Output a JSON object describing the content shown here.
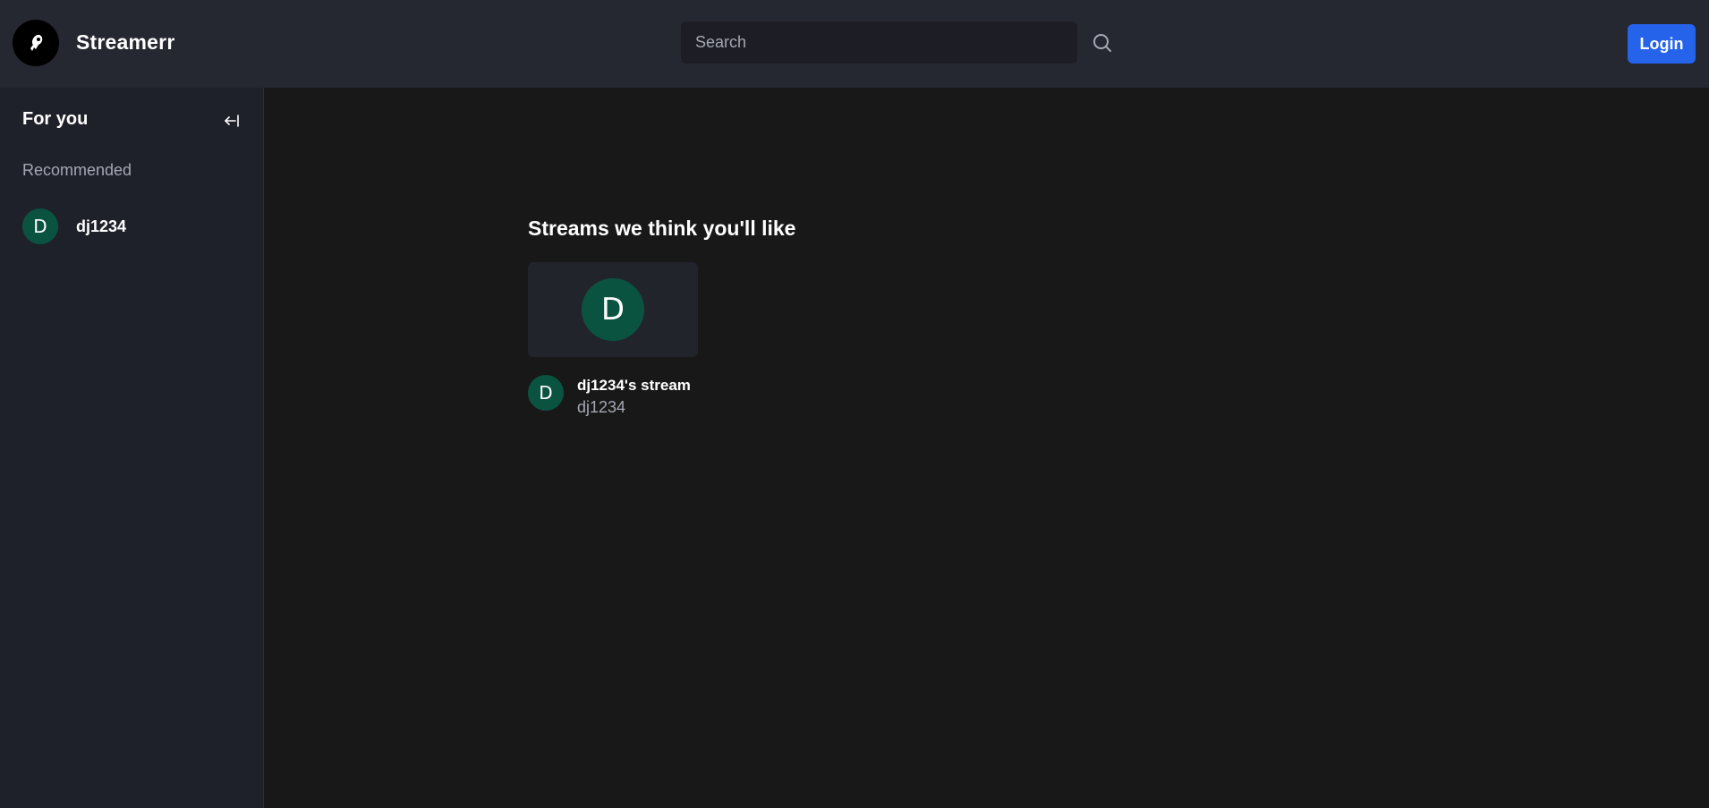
{
  "header": {
    "brand": "Streamerr",
    "search_placeholder": "Search",
    "login_label": "Login"
  },
  "sidebar": {
    "title": "For you",
    "section_label": "Recommended",
    "users": [
      {
        "initial": "D",
        "name": "dj1234"
      }
    ]
  },
  "main": {
    "heading": "Streams we think you'll like",
    "streams": [
      {
        "initial": "D",
        "title": "dj1234's stream",
        "username": "dj1234"
      }
    ]
  },
  "colors": {
    "navbar_bg": "#252731",
    "sidebar_bg": "#1f212a",
    "page_bg": "#181818",
    "accent": "#2563eb",
    "avatar_bg": "#0b5341",
    "muted_text": "#a4a7b4"
  },
  "icons": {
    "logo": "logo-icon",
    "search": "search-icon",
    "collapse": "arrow-left-to-line-icon"
  }
}
